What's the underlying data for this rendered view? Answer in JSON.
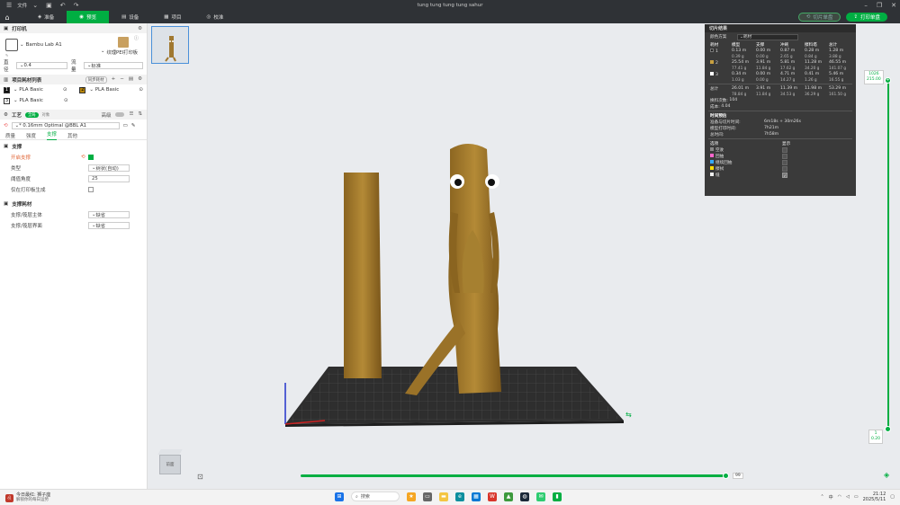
{
  "window": {
    "title": "tung tung tung tung sahur",
    "file_menu": "文件"
  },
  "nav": {
    "tabs": [
      {
        "label": "准备",
        "icon": "cube-icon"
      },
      {
        "label": "预览",
        "icon": "preview-icon"
      },
      {
        "label": "设备",
        "icon": "device-icon"
      },
      {
        "label": "项目",
        "icon": "project-icon"
      },
      {
        "label": "校准",
        "icon": "calibrate-icon"
      }
    ],
    "slice_button": "切片单盘",
    "print_button": "打印单盘"
  },
  "printer": {
    "section_title": "打印机",
    "name": "Bambu Lab A1",
    "plate_type": "纹理PEI打印板",
    "nozzle_label": "直径",
    "nozzle_value": "0.4",
    "flow_label": "流量",
    "flow_value": "标准"
  },
  "filaments": {
    "section_title": "项目耗材列表",
    "sync_button": "同步耗材",
    "items": [
      {
        "index": "1",
        "name": "PLA Basic",
        "color": "#111111"
      },
      {
        "index": "2",
        "name": "PLA Basic",
        "color": "#b8860b"
      },
      {
        "index": "3",
        "name": "PLA Basic",
        "color": "#ffffff"
      }
    ]
  },
  "process": {
    "section_title": "工艺",
    "global_toggle": "全局",
    "object_toggle": "对象",
    "advanced_label": "高级",
    "preset": "* 0.16mm Optimal @BBL A1",
    "subtabs": [
      "质量",
      "强度",
      "支撑",
      "其他"
    ],
    "active_subtab": "支撑",
    "support_group": "支撑",
    "enable_support_label": "开启支撑",
    "enable_support": true,
    "type_label": "类型",
    "type_value": "树状(自动)",
    "threshold_label": "阈值角度",
    "threshold_value": "25",
    "build_plate_only_label": "仅在打印板生成",
    "build_plate_only": false,
    "filament_group": "支撑耗材",
    "base_label": "支撑/筏层主体",
    "base_value": "缺省",
    "interface_label": "支撑/筏层界面",
    "interface_value": "缺省"
  },
  "slice_result": {
    "title": "切片结果",
    "scheme_label": "颜色方案",
    "scheme_value": "耗材",
    "columns": [
      "耗材",
      "模型",
      "支撑",
      "冲刷",
      "擦料塔",
      "总计"
    ],
    "rows": [
      {
        "id": "1",
        "color": "#222222",
        "model": [
          "0.13 m",
          "0.39 g"
        ],
        "support": [
          "0.00 m",
          "0.00 g"
        ],
        "flush": [
          "0.87 m",
          "2.65 g"
        ],
        "tower": [
          "0.28 m",
          "0.84 g"
        ],
        "total": [
          "1.28 m",
          "3.88 g"
        ]
      },
      {
        "id": "2",
        "color": "#c8a040",
        "model": [
          "25.54 m",
          "77.41 g"
        ],
        "support": [
          "3.91 m",
          "11.84 g"
        ],
        "flush": [
          "5.81 m",
          "17.62 g"
        ],
        "tower": [
          "11.28 m",
          "34.20 g"
        ],
        "total": [
          "46.55 m",
          "141.07 g"
        ]
      },
      {
        "id": "3",
        "color": "#ffffff",
        "model": [
          "0.34 m",
          "1.03 g"
        ],
        "support": [
          "0.00 m",
          "0.00 g"
        ],
        "flush": [
          "4.71 m",
          "14.27 g"
        ],
        "tower": [
          "0.41 m",
          "1.26 g"
        ],
        "total": [
          "5.46 m",
          "16.55 g"
        ]
      }
    ],
    "sum": {
      "label": "总计",
      "model": [
        "26.01 m",
        "78.84 g"
      ],
      "support": [
        "3.91 m",
        "11.84 g"
      ],
      "flush": [
        "11.39 m",
        "34.53 g"
      ],
      "tower": [
        "11.98 m",
        "36.29 g"
      ],
      "total": [
        "53.29 m",
        "161.50 g"
      ]
    },
    "changes_label": "换料次数:",
    "changes_value": "104",
    "cost_label": "成本:",
    "cost_value": "4.04",
    "time_title": "时间预估",
    "prep_label": "准备与切片时间:",
    "prep_value": "6m18s + 30m26s",
    "model_time_label": "模型打印时间:",
    "model_time_value": "7h21m",
    "total_time_label": "总时间:",
    "total_time_value": "7h58m",
    "options_label": "选项",
    "display_label": "显示",
    "options": [
      {
        "label": "空驶",
        "color": "#888888",
        "shown": false
      },
      {
        "label": "回抽",
        "color": "#ff66cc",
        "shown": false
      },
      {
        "label": "继续回抽",
        "color": "#33aaff",
        "shown": false
      },
      {
        "label": "擦拭",
        "color": "#ffdd00",
        "shown": false
      },
      {
        "label": "缝",
        "color": "#eeeeee",
        "shown": true
      }
    ]
  },
  "layer_slider": {
    "top_value": "1026",
    "top_height": "215.00",
    "bottom_value": "1",
    "bottom_height": "0.20"
  },
  "move_slider": {
    "value": "99"
  },
  "view_cube": {
    "label": "前面"
  },
  "taskbar": {
    "weather_line1": "今日最红: 狮子座",
    "weather_line2": "解锁你的每日运势",
    "search": "搜索",
    "time": "21:12",
    "date": "2025/5/11",
    "lang": "中"
  }
}
